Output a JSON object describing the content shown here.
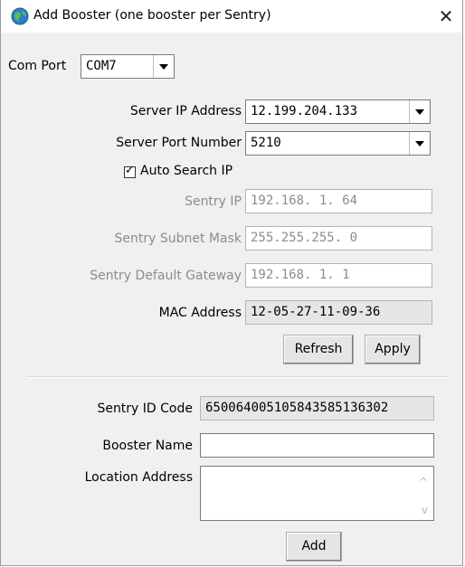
{
  "window": {
    "title": "Add Booster (one booster per Sentry)",
    "close_glyph": "✕"
  },
  "com_port": {
    "label": "Com Port",
    "value": "COM7"
  },
  "server": {
    "ip_label": "Server IP Address",
    "ip_value": "12.199.204.133",
    "port_label": "Server Port Number",
    "port_value": "5210"
  },
  "auto_search": {
    "label": "Auto Search IP",
    "checked": true,
    "check_glyph": "✓"
  },
  "sentry": {
    "ip_label": "Sentry IP",
    "ip_value": "192.168.  1. 64",
    "subnet_label": "Sentry Subnet Mask",
    "subnet_value": "255.255.255.  0",
    "gateway_label": "Sentry Default Gateway",
    "gateway_value": "192.168.  1.  1",
    "mac_label": "MAC Address",
    "mac_value": "12-05-27-11-09-36"
  },
  "buttons": {
    "refresh": "Refresh",
    "apply": "Apply",
    "add": "Add"
  },
  "booster": {
    "id_label": "Sentry ID Code",
    "id_value": "65006400510584358513630​2",
    "name_label": "Booster Name",
    "name_value": "",
    "location_label": "Location Address",
    "location_value": ""
  },
  "icons": {
    "app": "globe-app-icon",
    "pointer": "arrow-pointer-icon",
    "scroll_up": "^",
    "scroll_down": "v"
  }
}
